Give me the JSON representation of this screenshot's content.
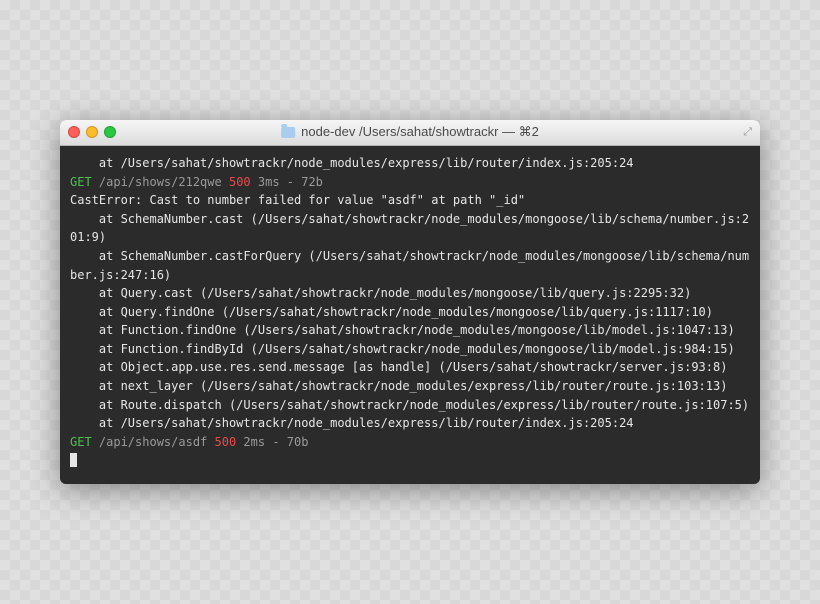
{
  "window": {
    "title": "node-dev  /Users/sahat/showtrackr — ⌘2"
  },
  "lines": [
    {
      "segments": [
        {
          "text": "    at /Users/sahat/showtrackr/node_modules/express/lib/router/index.js:205:24"
        }
      ]
    },
    {
      "segments": [
        {
          "text": "GET",
          "class": "green"
        },
        {
          "text": " /api/shows/212qwe ",
          "class": "dim"
        },
        {
          "text": "500",
          "class": "red"
        },
        {
          "text": " 3ms - 72b",
          "class": "dim"
        }
      ]
    },
    {
      "segments": [
        {
          "text": "CastError: Cast to number failed for value \"asdf\" at path \"_id\""
        }
      ]
    },
    {
      "segments": [
        {
          "text": "    at SchemaNumber.cast (/Users/sahat/showtrackr/node_modules/mongoose/lib/schema/number.js:201:9)"
        }
      ]
    },
    {
      "segments": [
        {
          "text": "    at SchemaNumber.castForQuery (/Users/sahat/showtrackr/node_modules/mongoose/lib/schema/number.js:247:16)"
        }
      ]
    },
    {
      "segments": [
        {
          "text": "    at Query.cast (/Users/sahat/showtrackr/node_modules/mongoose/lib/query.js:2295:32)"
        }
      ]
    },
    {
      "segments": [
        {
          "text": "    at Query.findOne (/Users/sahat/showtrackr/node_modules/mongoose/lib/query.js:1117:10)"
        }
      ]
    },
    {
      "segments": [
        {
          "text": "    at Function.findOne (/Users/sahat/showtrackr/node_modules/mongoose/lib/model.js:1047:13)"
        }
      ]
    },
    {
      "segments": [
        {
          "text": "    at Function.findById (/Users/sahat/showtrackr/node_modules/mongoose/lib/model.js:984:15)"
        }
      ]
    },
    {
      "segments": [
        {
          "text": "    at Object.app.use.res.send.message [as handle] (/Users/sahat/showtrackr/server.js:93:8)"
        }
      ]
    },
    {
      "segments": [
        {
          "text": "    at next_layer (/Users/sahat/showtrackr/node_modules/express/lib/router/route.js:103:13)"
        }
      ]
    },
    {
      "segments": [
        {
          "text": "    at Route.dispatch (/Users/sahat/showtrackr/node_modules/express/lib/router/route.js:107:5)"
        }
      ]
    },
    {
      "segments": [
        {
          "text": "    at /Users/sahat/showtrackr/node_modules/express/lib/router/index.js:205:24"
        }
      ]
    },
    {
      "segments": [
        {
          "text": "GET",
          "class": "green"
        },
        {
          "text": " /api/shows/asdf ",
          "class": "dim"
        },
        {
          "text": "500",
          "class": "red"
        },
        {
          "text": " 2ms - 70b",
          "class": "dim"
        }
      ]
    }
  ]
}
